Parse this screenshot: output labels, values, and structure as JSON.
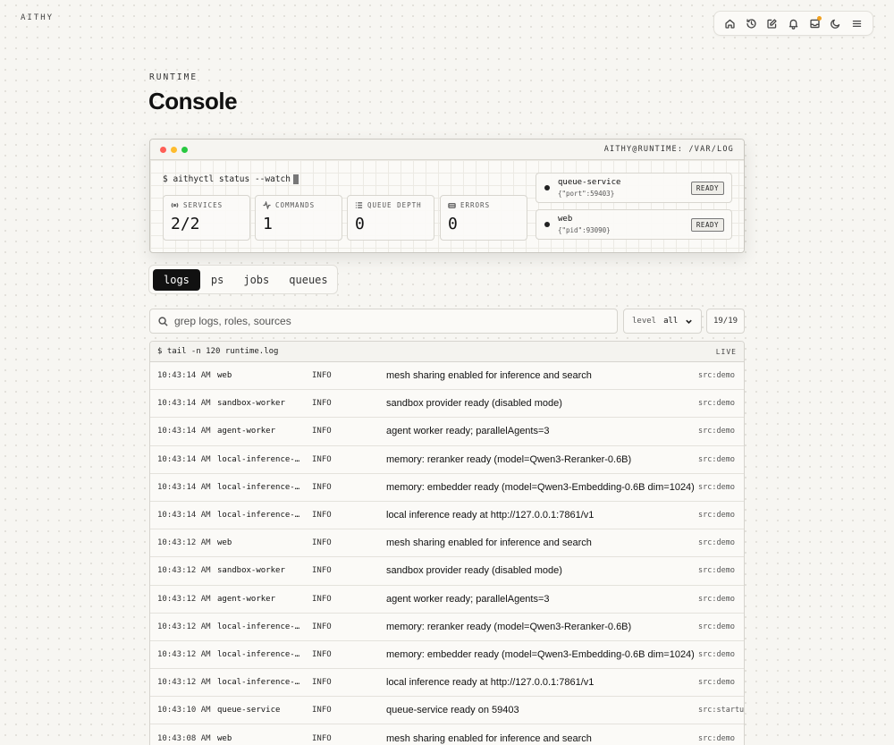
{
  "brand": "AITHY",
  "topbar": {
    "icons": [
      "home-icon",
      "history-icon",
      "edit-icon",
      "bell-icon",
      "inbox-icon",
      "moon-icon",
      "menu-icon"
    ],
    "notification_color": "#f0a020"
  },
  "header": {
    "eyebrow": "RUNTIME",
    "title": "Console"
  },
  "terminal": {
    "path": "AITHY@RUNTIME: /VAR/LOG",
    "command": "$ aithyctl status --watch",
    "window_dots": [
      "#ff5f57",
      "#febc2e",
      "#28c840"
    ],
    "stats": [
      {
        "label": "SERVICES",
        "value": "2/2"
      },
      {
        "label": "COMMANDS",
        "value": "1"
      },
      {
        "label": "QUEUE DEPTH",
        "value": "0"
      },
      {
        "label": "ERRORS",
        "value": "0"
      }
    ],
    "services": [
      {
        "name": "queue-service",
        "meta": "{\"port\":59403}",
        "status": "READY"
      },
      {
        "name": "web",
        "meta": "{\"pid\":93090}",
        "status": "READY"
      }
    ]
  },
  "tabs": [
    {
      "label": "logs",
      "active": true
    },
    {
      "label": "ps",
      "active": false
    },
    {
      "label": "jobs",
      "active": false
    },
    {
      "label": "queues",
      "active": false
    }
  ],
  "filters": {
    "search_placeholder": "grep logs, roles, sources",
    "level_label": "level",
    "level_value": "all",
    "count": "19/19"
  },
  "log": {
    "command": "$ tail -n 120 runtime.log",
    "live": "LIVE",
    "rows": [
      {
        "time": "10:43:14 AM",
        "source": "web",
        "level": "INFO",
        "message": "mesh sharing enabled for inference and search",
        "tag": "src:demo"
      },
      {
        "time": "10:43:14 AM",
        "source": "sandbox-worker",
        "level": "INFO",
        "message": "sandbox provider ready (disabled mode)",
        "tag": "src:demo"
      },
      {
        "time": "10:43:14 AM",
        "source": "agent-worker",
        "level": "INFO",
        "message": "agent worker ready; parallelAgents=3",
        "tag": "src:demo"
      },
      {
        "time": "10:43:14 AM",
        "source": "local-inference-worker",
        "level": "INFO",
        "message": "memory: reranker ready (model=Qwen3-Reranker-0.6B)",
        "tag": "src:demo"
      },
      {
        "time": "10:43:14 AM",
        "source": "local-inference-worker",
        "level": "INFO",
        "message": "memory: embedder ready (model=Qwen3-Embedding-0.6B dim=1024)",
        "tag": "src:demo"
      },
      {
        "time": "10:43:14 AM",
        "source": "local-inference-worker",
        "level": "INFO",
        "message": "local inference ready at http://127.0.0.1:7861/v1",
        "tag": "src:demo"
      },
      {
        "time": "10:43:12 AM",
        "source": "web",
        "level": "INFO",
        "message": "mesh sharing enabled for inference and search",
        "tag": "src:demo"
      },
      {
        "time": "10:43:12 AM",
        "source": "sandbox-worker",
        "level": "INFO",
        "message": "sandbox provider ready (disabled mode)",
        "tag": "src:demo"
      },
      {
        "time": "10:43:12 AM",
        "source": "agent-worker",
        "level": "INFO",
        "message": "agent worker ready; parallelAgents=3",
        "tag": "src:demo"
      },
      {
        "time": "10:43:12 AM",
        "source": "local-inference-worker",
        "level": "INFO",
        "message": "memory: reranker ready (model=Qwen3-Reranker-0.6B)",
        "tag": "src:demo"
      },
      {
        "time": "10:43:12 AM",
        "source": "local-inference-worker",
        "level": "INFO",
        "message": "memory: embedder ready (model=Qwen3-Embedding-0.6B dim=1024)",
        "tag": "src:demo"
      },
      {
        "time": "10:43:12 AM",
        "source": "local-inference-worker",
        "level": "INFO",
        "message": "local inference ready at http://127.0.0.1:7861/v1",
        "tag": "src:demo"
      },
      {
        "time": "10:43:10 AM",
        "source": "queue-service",
        "level": "INFO",
        "message": "queue-service ready on 59403",
        "tag": "src:startup"
      },
      {
        "time": "10:43:08 AM",
        "source": "web",
        "level": "INFO",
        "message": "mesh sharing enabled for inference and search",
        "tag": "src:demo"
      }
    ]
  }
}
